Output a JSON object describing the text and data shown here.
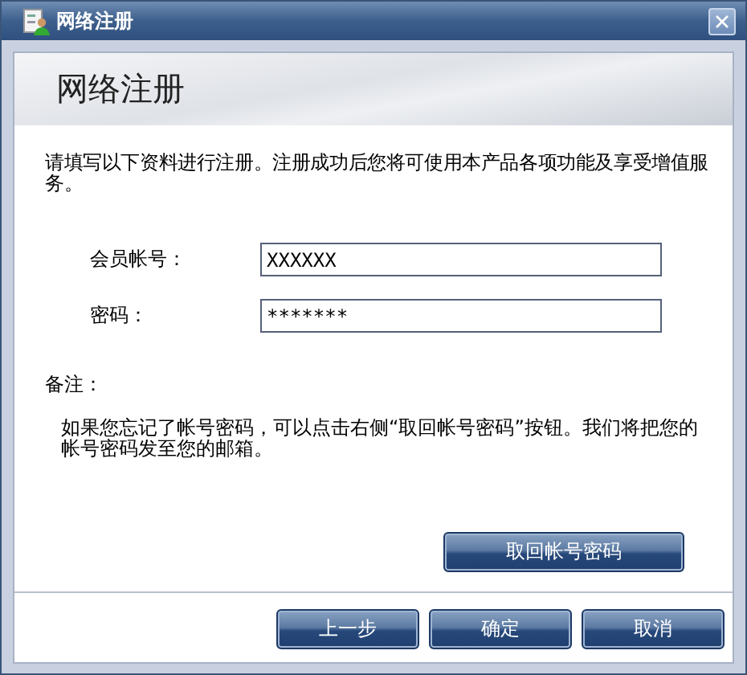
{
  "window": {
    "title": "网络注册"
  },
  "header": {
    "title": "网络注册"
  },
  "intro": "请填写以下资料进行注册。注册成功后您将可使用本产品各项功能及享受增值服务。",
  "fields": [
    {
      "label": "会员帐号：",
      "value": "XXXXXX"
    },
    {
      "label": "密码：",
      "value": "*******"
    }
  ],
  "note": {
    "label": "备注：",
    "text": "如果您忘记了帐号密码，可以点击右侧“取回帐号密码”按钮。我们将把您的帐号密码发至您的邮箱。"
  },
  "retrieve_button": "取回帐号密码",
  "buttons": [
    "上一步",
    "确定",
    "取消"
  ]
}
